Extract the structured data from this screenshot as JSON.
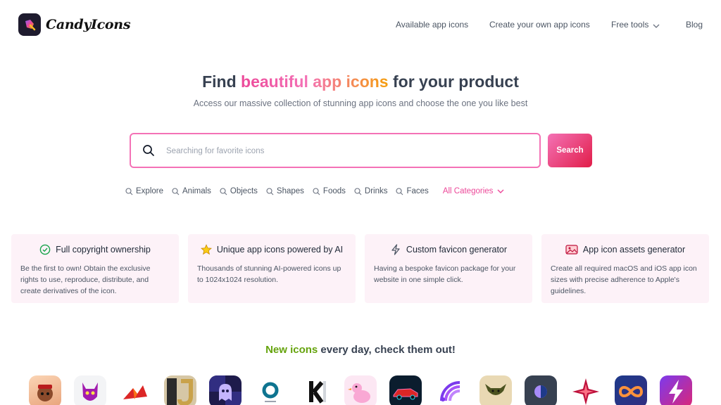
{
  "brand": {
    "name": "CandyIcons"
  },
  "nav": {
    "available": "Available app icons",
    "create": "Create your own app icons",
    "free_tools": "Free tools",
    "blog": "Blog"
  },
  "hero": {
    "title_before": "Find ",
    "title_highlight": "beautiful app icons",
    "title_after": " for your product",
    "subtitle": "Access our massive collection of stunning app icons and choose the one you like best"
  },
  "search": {
    "placeholder": "Searching for favorite icons",
    "value": "",
    "button_label": "Search"
  },
  "categories": [
    "Explore",
    "Animals",
    "Objects",
    "Shapes",
    "Foods",
    "Drinks",
    "Faces"
  ],
  "all_categories": "All Categories",
  "features": [
    {
      "icon": "check-circle-icon",
      "title": "Full copyright ownership",
      "desc": "Be the first to own! Obtain the exclusive rights to use, reproduce, distribute, and create derivatives of the icon."
    },
    {
      "icon": "star-icon",
      "title": "Unique app icons powered by AI",
      "desc": "Thousands of stunning AI-powered icons up to 1024x1024 resolution."
    },
    {
      "icon": "lightning-icon",
      "title": "Custom favicon generator",
      "desc": "Having a bespoke favicon package for your website in one simple click."
    },
    {
      "icon": "image-icon",
      "title": "App icon assets generator",
      "desc": "Create all required macOS and iOS app icon sizes with precise adherence to Apple's guidelines."
    }
  ],
  "new_icons": {
    "highlight": "New icons",
    "rest": " every day, check them out!"
  },
  "colors": {
    "accent_pink": "#ec4899",
    "search_border": "#f472b6",
    "feature_bg": "#fdf2f8",
    "new_green": "#65a30d"
  },
  "icon_gallery": [
    "monkey-icon",
    "devil-icon",
    "origami-bird-icon",
    "letter-j-icon",
    "ghost-icon",
    "o-ring-icon",
    "letter-k-icon",
    "duck-icon",
    "sports-car-icon",
    "wifi-rainbow-icon",
    "bull-icon",
    "eclipse-icon",
    "star-flower-icon",
    "infinity-icon",
    "lightning-icon"
  ]
}
